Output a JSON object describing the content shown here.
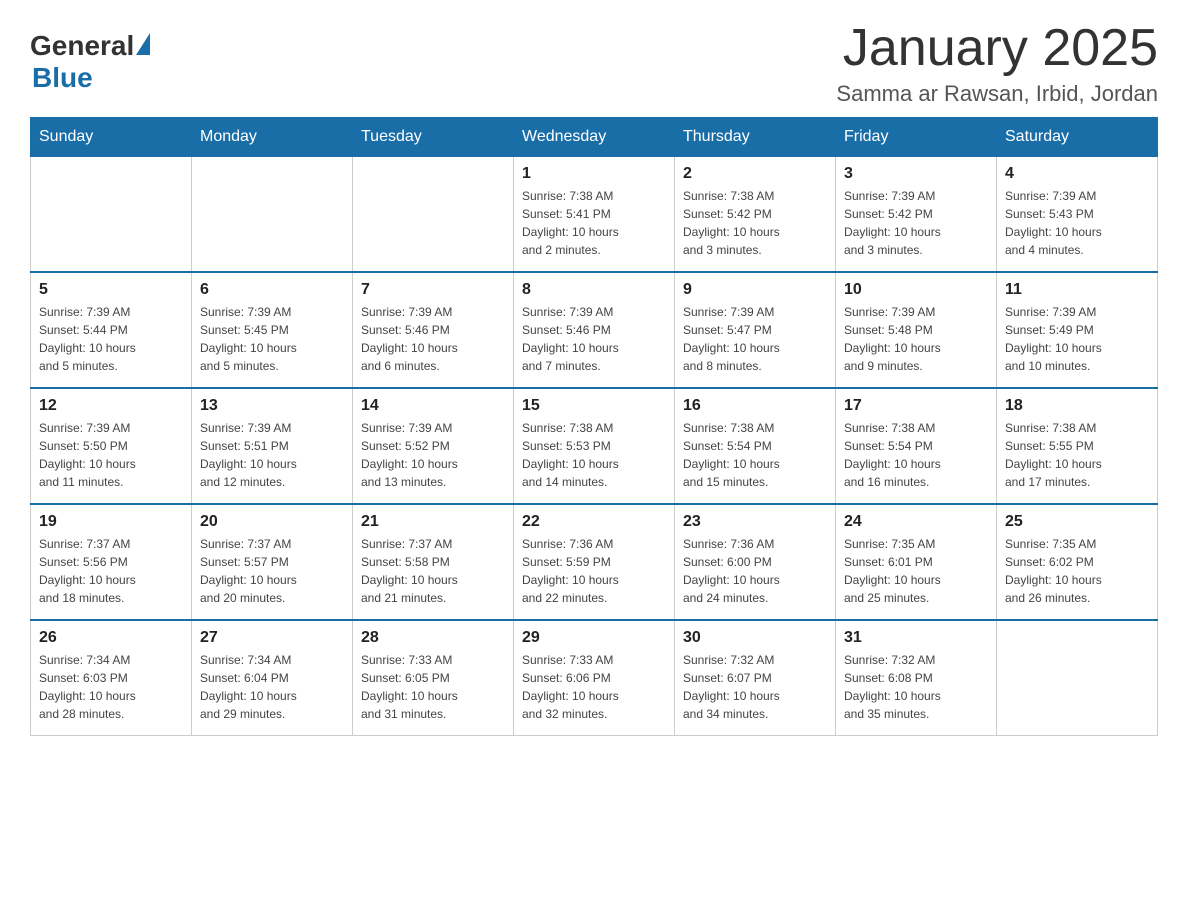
{
  "header": {
    "logo": {
      "general": "General",
      "blue": "Blue",
      "subtitle": "Blue"
    },
    "title": "January 2025",
    "subtitle": "Samma ar Rawsan, Irbid, Jordan"
  },
  "calendar": {
    "days_of_week": [
      "Sunday",
      "Monday",
      "Tuesday",
      "Wednesday",
      "Thursday",
      "Friday",
      "Saturday"
    ],
    "weeks": [
      [
        {
          "day": "",
          "info": ""
        },
        {
          "day": "",
          "info": ""
        },
        {
          "day": "",
          "info": ""
        },
        {
          "day": "1",
          "info": "Sunrise: 7:38 AM\nSunset: 5:41 PM\nDaylight: 10 hours\nand 2 minutes."
        },
        {
          "day": "2",
          "info": "Sunrise: 7:38 AM\nSunset: 5:42 PM\nDaylight: 10 hours\nand 3 minutes."
        },
        {
          "day": "3",
          "info": "Sunrise: 7:39 AM\nSunset: 5:42 PM\nDaylight: 10 hours\nand 3 minutes."
        },
        {
          "day": "4",
          "info": "Sunrise: 7:39 AM\nSunset: 5:43 PM\nDaylight: 10 hours\nand 4 minutes."
        }
      ],
      [
        {
          "day": "5",
          "info": "Sunrise: 7:39 AM\nSunset: 5:44 PM\nDaylight: 10 hours\nand 5 minutes."
        },
        {
          "day": "6",
          "info": "Sunrise: 7:39 AM\nSunset: 5:45 PM\nDaylight: 10 hours\nand 5 minutes."
        },
        {
          "day": "7",
          "info": "Sunrise: 7:39 AM\nSunset: 5:46 PM\nDaylight: 10 hours\nand 6 minutes."
        },
        {
          "day": "8",
          "info": "Sunrise: 7:39 AM\nSunset: 5:46 PM\nDaylight: 10 hours\nand 7 minutes."
        },
        {
          "day": "9",
          "info": "Sunrise: 7:39 AM\nSunset: 5:47 PM\nDaylight: 10 hours\nand 8 minutes."
        },
        {
          "day": "10",
          "info": "Sunrise: 7:39 AM\nSunset: 5:48 PM\nDaylight: 10 hours\nand 9 minutes."
        },
        {
          "day": "11",
          "info": "Sunrise: 7:39 AM\nSunset: 5:49 PM\nDaylight: 10 hours\nand 10 minutes."
        }
      ],
      [
        {
          "day": "12",
          "info": "Sunrise: 7:39 AM\nSunset: 5:50 PM\nDaylight: 10 hours\nand 11 minutes."
        },
        {
          "day": "13",
          "info": "Sunrise: 7:39 AM\nSunset: 5:51 PM\nDaylight: 10 hours\nand 12 minutes."
        },
        {
          "day": "14",
          "info": "Sunrise: 7:39 AM\nSunset: 5:52 PM\nDaylight: 10 hours\nand 13 minutes."
        },
        {
          "day": "15",
          "info": "Sunrise: 7:38 AM\nSunset: 5:53 PM\nDaylight: 10 hours\nand 14 minutes."
        },
        {
          "day": "16",
          "info": "Sunrise: 7:38 AM\nSunset: 5:54 PM\nDaylight: 10 hours\nand 15 minutes."
        },
        {
          "day": "17",
          "info": "Sunrise: 7:38 AM\nSunset: 5:54 PM\nDaylight: 10 hours\nand 16 minutes."
        },
        {
          "day": "18",
          "info": "Sunrise: 7:38 AM\nSunset: 5:55 PM\nDaylight: 10 hours\nand 17 minutes."
        }
      ],
      [
        {
          "day": "19",
          "info": "Sunrise: 7:37 AM\nSunset: 5:56 PM\nDaylight: 10 hours\nand 18 minutes."
        },
        {
          "day": "20",
          "info": "Sunrise: 7:37 AM\nSunset: 5:57 PM\nDaylight: 10 hours\nand 20 minutes."
        },
        {
          "day": "21",
          "info": "Sunrise: 7:37 AM\nSunset: 5:58 PM\nDaylight: 10 hours\nand 21 minutes."
        },
        {
          "day": "22",
          "info": "Sunrise: 7:36 AM\nSunset: 5:59 PM\nDaylight: 10 hours\nand 22 minutes."
        },
        {
          "day": "23",
          "info": "Sunrise: 7:36 AM\nSunset: 6:00 PM\nDaylight: 10 hours\nand 24 minutes."
        },
        {
          "day": "24",
          "info": "Sunrise: 7:35 AM\nSunset: 6:01 PM\nDaylight: 10 hours\nand 25 minutes."
        },
        {
          "day": "25",
          "info": "Sunrise: 7:35 AM\nSunset: 6:02 PM\nDaylight: 10 hours\nand 26 minutes."
        }
      ],
      [
        {
          "day": "26",
          "info": "Sunrise: 7:34 AM\nSunset: 6:03 PM\nDaylight: 10 hours\nand 28 minutes."
        },
        {
          "day": "27",
          "info": "Sunrise: 7:34 AM\nSunset: 6:04 PM\nDaylight: 10 hours\nand 29 minutes."
        },
        {
          "day": "28",
          "info": "Sunrise: 7:33 AM\nSunset: 6:05 PM\nDaylight: 10 hours\nand 31 minutes."
        },
        {
          "day": "29",
          "info": "Sunrise: 7:33 AM\nSunset: 6:06 PM\nDaylight: 10 hours\nand 32 minutes."
        },
        {
          "day": "30",
          "info": "Sunrise: 7:32 AM\nSunset: 6:07 PM\nDaylight: 10 hours\nand 34 minutes."
        },
        {
          "day": "31",
          "info": "Sunrise: 7:32 AM\nSunset: 6:08 PM\nDaylight: 10 hours\nand 35 minutes."
        },
        {
          "day": "",
          "info": ""
        }
      ]
    ]
  }
}
